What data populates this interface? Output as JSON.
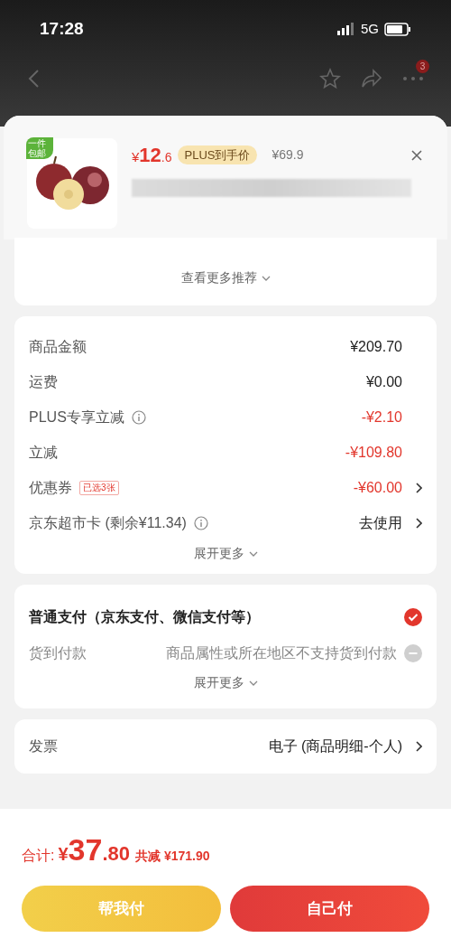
{
  "status_bar": {
    "time": "17:28",
    "network": "5G"
  },
  "nav": {
    "badge": "3"
  },
  "product": {
    "ribbon": "一件包邮",
    "price_symbol": "¥",
    "price_int": "12",
    "price_dec": ".6",
    "plus_tag": "PLUS到手价",
    "original_price": "¥69.9"
  },
  "recommend": {
    "more_label": "查看更多推荐"
  },
  "amounts": [
    {
      "label": "商品金额",
      "value": "¥209.70",
      "kind": "plain",
      "info": false,
      "chevron": false
    },
    {
      "label": "运费",
      "value": "¥0.00",
      "kind": "plain",
      "info": false,
      "chevron": false
    },
    {
      "label": "PLUS专享立减",
      "value": "-¥2.10",
      "kind": "discount",
      "info": true,
      "chevron": false
    },
    {
      "label": "立减",
      "value": "-¥109.80",
      "kind": "discount",
      "info": false,
      "chevron": false
    },
    {
      "label": "优惠券",
      "tag": "已选3张",
      "value": "-¥60.00",
      "kind": "discount",
      "info": false,
      "chevron": true
    },
    {
      "label": "京东超市卡 (剩余¥11.34)",
      "value": "去使用",
      "kind": "plain",
      "info": true,
      "chevron": true
    }
  ],
  "amounts_more": "展开更多",
  "payment_options": [
    {
      "label": "普通支付（京东支付、微信支付等）",
      "selected": true,
      "disabled": false
    },
    {
      "label": "货到付款",
      "note": "商品属性或所在地区不支持货到付款",
      "selected": false,
      "disabled": true
    }
  ],
  "payment_more": "展开更多",
  "invoice": {
    "label": "发票",
    "value": "电子 (商品明细-个人)"
  },
  "footer": {
    "total_label": "合计:",
    "total_symbol": "¥",
    "total_int": "37",
    "total_dec": ".80",
    "saved": "共减 ¥171.90",
    "buttons": [
      {
        "label": "帮我付",
        "kind": "secondary"
      },
      {
        "label": "自己付",
        "kind": "primary"
      }
    ]
  }
}
